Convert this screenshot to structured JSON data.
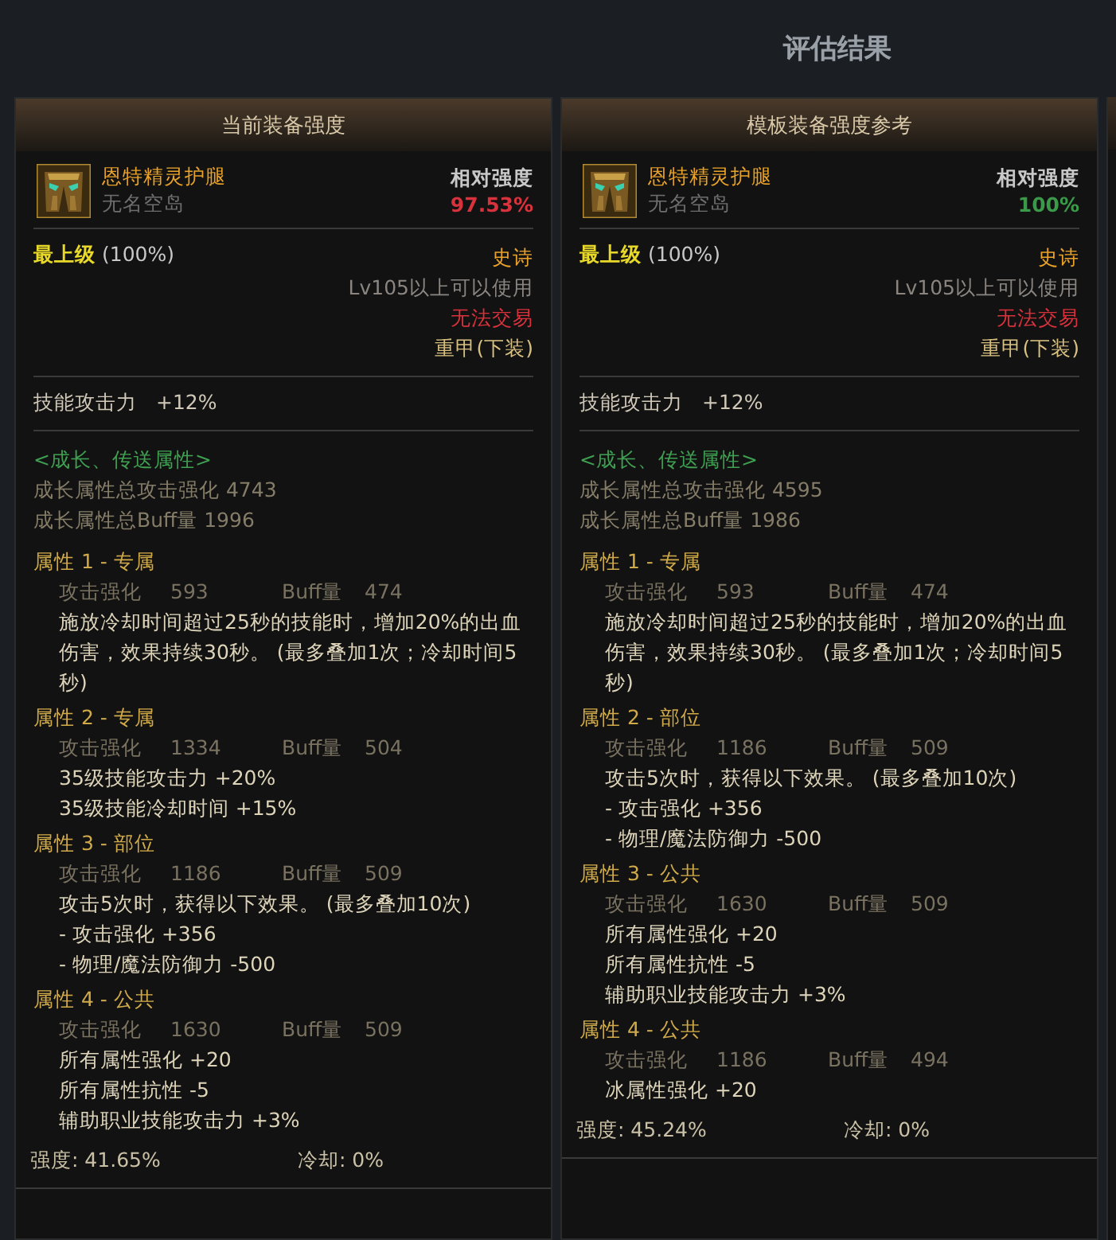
{
  "page_title": "评估结果",
  "cards": [
    {
      "title": "当前装备强度",
      "item_name": "恩特精灵护腿",
      "server": "无名空岛",
      "relative_label": "相对强度",
      "relative_value": "97.53%",
      "color": "#d8323c",
      "grade": "最上级",
      "grade_pct": "(100%)",
      "rarity": "史诗",
      "level_req": "Lv105以上可以使用",
      "trade": "无法交易",
      "slot": "重甲(下装)",
      "skill_label": "技能攻击力",
      "skill_value": "+12%",
      "growth_heading": "<成长、传送属性>",
      "growth_lines": [
        "成长属性总攻击强化 4743",
        "成长属性总Buff量 1996"
      ],
      "attributes": [
        {
          "title": "属性 1 - 专属",
          "attack_label": "攻击强化",
          "attack": "593",
          "buff_label": "Buff量",
          "buff": "474",
          "effects": [
            "施放冷却时间超过25秒的技能时，增加20%的出血伤害，效果持续30秒。 (最多叠加1次；冷却时间5秒)"
          ]
        },
        {
          "title": "属性 2 - 专属",
          "attack_label": "攻击强化",
          "attack": "1334",
          "buff_label": "Buff量",
          "buff": "504",
          "effects": [
            "35级技能攻击力 +20%",
            "35级技能冷却时间 +15%"
          ]
        },
        {
          "title": "属性 3 - 部位",
          "attack_label": "攻击强化",
          "attack": "1186",
          "buff_label": "Buff量",
          "buff": "509",
          "effects": [
            "攻击5次时，获得以下效果。 (最多叠加10次)",
            "- 攻击强化 +356",
            "- 物理/魔法防御力 -500"
          ]
        },
        {
          "title": "属性 4 - 公共",
          "attack_label": "攻击强化",
          "attack": "1630",
          "buff_label": "Buff量",
          "buff": "509",
          "effects": [
            "所有属性强化 +20",
            "所有属性抗性 -5",
            "辅助职业技能攻击力 +3%"
          ]
        }
      ],
      "strength": "强度: 41.65%",
      "cooldown": "冷却: 0%"
    },
    {
      "title": "模板装备强度参考",
      "item_name": "恩特精灵护腿",
      "server": "无名空岛",
      "relative_label": "相对强度",
      "relative_value": "100%",
      "color": "#3a9a4a",
      "grade": "最上级",
      "grade_pct": "(100%)",
      "rarity": "史诗",
      "level_req": "Lv105以上可以使用",
      "trade": "无法交易",
      "slot": "重甲(下装)",
      "skill_label": "技能攻击力",
      "skill_value": "+12%",
      "growth_heading": "<成长、传送属性>",
      "growth_lines": [
        "成长属性总攻击强化 4595",
        "成长属性总Buff量 1986"
      ],
      "attributes": [
        {
          "title": "属性 1 - 专属",
          "attack_label": "攻击强化",
          "attack": "593",
          "buff_label": "Buff量",
          "buff": "474",
          "effects": [
            "施放冷却时间超过25秒的技能时，增加20%的出血伤害，效果持续30秒。 (最多叠加1次；冷却时间5秒)"
          ]
        },
        {
          "title": "属性 2 - 部位",
          "attack_label": "攻击强化",
          "attack": "1186",
          "buff_label": "Buff量",
          "buff": "509",
          "effects": [
            "攻击5次时，获得以下效果。 (最多叠加10次)",
            "- 攻击强化 +356",
            "- 物理/魔法防御力 -500"
          ]
        },
        {
          "title": "属性 3 - 公共",
          "attack_label": "攻击强化",
          "attack": "1630",
          "buff_label": "Buff量",
          "buff": "509",
          "effects": [
            "所有属性强化 +20",
            "所有属性抗性 -5",
            "辅助职业技能攻击力 +3%"
          ]
        },
        {
          "title": "属性 4 - 公共",
          "attack_label": "攻击强化",
          "attack": "1186",
          "buff_label": "Buff量",
          "buff": "494",
          "effects": [
            "冰属性强化 +20"
          ]
        }
      ],
      "strength": "强度: 45.24%",
      "cooldown": "冷却: 0%"
    }
  ]
}
